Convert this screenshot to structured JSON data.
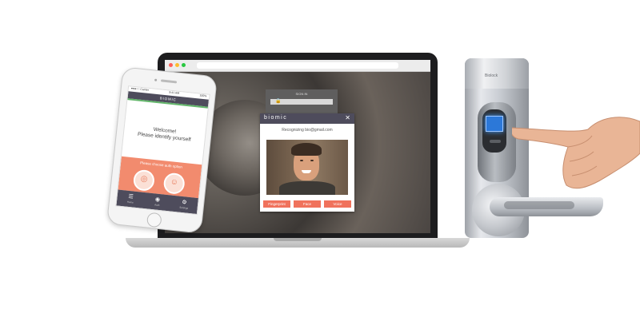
{
  "laptop": {
    "background_login_title": "SIGN IN",
    "modal": {
      "brand": "biomic",
      "close": "✕",
      "status_text": "Recognizing bio@gmail.com",
      "buttons": [
        "Fingerprint",
        "Face",
        "Voice"
      ]
    }
  },
  "phone": {
    "status_left": "●●●○○ Carrier",
    "status_center": "9:41 AM",
    "status_right": "100%",
    "app_title": "BIOMIC",
    "welcome_line1": "Welcome!",
    "welcome_line2": "Please identify yourself",
    "choose_text": "Please choose auth option",
    "tabs": [
      {
        "icon": "☰",
        "label": "Home"
      },
      {
        "icon": "◉",
        "label": "Auth"
      },
      {
        "icon": "⚙",
        "label": "Settings"
      }
    ]
  },
  "door_lock": {
    "brand": "Biolock"
  },
  "colors": {
    "brand_dark": "#4e4c5c",
    "accent_orange": "#f0725c",
    "success_green": "#62b56a",
    "sensor_blue": "#2c78d8"
  }
}
